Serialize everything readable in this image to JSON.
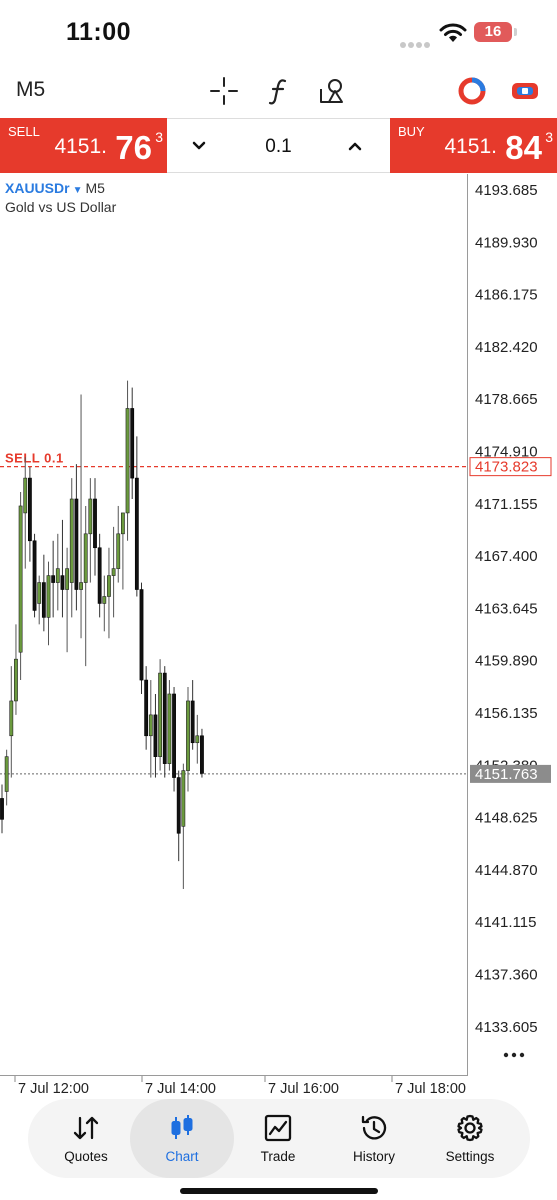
{
  "status_bar": {
    "time": "11:00",
    "battery": "16"
  },
  "toolbar": {
    "timeframe": "M5",
    "icons": [
      "crosshair-icon",
      "function-icon",
      "objects-icon",
      "account-icon",
      "one-click-trading-icon"
    ]
  },
  "trade": {
    "sell_label": "SELL",
    "sell_price_prefix": "4151.",
    "sell_price_big": "76",
    "sell_price_sup": "3",
    "buy_label": "BUY",
    "buy_price_prefix": "4151.",
    "buy_price_big": "84",
    "buy_price_sup": "3",
    "lot": "0.1"
  },
  "chart_header": {
    "symbol": "XAUUSDr",
    "timeframe": "M5",
    "description": "Gold vs US Dollar"
  },
  "colors": {
    "sell": "#e63a2c",
    "buy": "#e63a2c",
    "bull_candle": "#6b9a3e",
    "bear_candle": "#111111",
    "accent": "#1e6fe0",
    "order_line": "#e63a2c"
  },
  "chart_data": {
    "type": "candlestick",
    "price_axis": [
      "4193.685",
      "4189.930",
      "4186.175",
      "4182.420",
      "4178.665",
      "4174.910",
      "4171.155",
      "4167.400",
      "4163.645",
      "4159.890",
      "4156.135",
      "4152.380",
      "4148.625",
      "4144.870",
      "4141.115",
      "4137.360",
      "4133.605"
    ],
    "time_axis": [
      "7 Jul 12:00",
      "7 Jul 14:00",
      "7 Jul 16:00",
      "7 Jul 18:00"
    ],
    "order_line": {
      "label": "SELL 0.1",
      "price": 4173.823,
      "price_label": "4173.823"
    },
    "current_price": {
      "price": 4151.763,
      "price_label": "4151.763"
    },
    "ylim": [
      4130.0,
      4195.0
    ],
    "candles": [
      {
        "o": 4150.0,
        "h": 4151.0,
        "l": 4147.5,
        "c": 4148.5
      },
      {
        "o": 4150.5,
        "h": 4153.5,
        "l": 4149.5,
        "c": 4153.0
      },
      {
        "o": 4154.5,
        "h": 4159.5,
        "l": 4151.5,
        "c": 4157.0
      },
      {
        "o": 4157.0,
        "h": 4162.5,
        "l": 4156.0,
        "c": 4160.0
      },
      {
        "o": 4160.5,
        "h": 4172.0,
        "l": 4158.5,
        "c": 4171.0
      },
      {
        "o": 4170.5,
        "h": 4174.5,
        "l": 4166.5,
        "c": 4173.0
      },
      {
        "o": 4173.0,
        "h": 4173.8,
        "l": 4167.0,
        "c": 4168.5
      },
      {
        "o": 4168.5,
        "h": 4169.0,
        "l": 4163.0,
        "c": 4163.5
      },
      {
        "o": 4164.0,
        "h": 4166.0,
        "l": 4162.5,
        "c": 4165.5
      },
      {
        "o": 4165.5,
        "h": 4167.5,
        "l": 4162.0,
        "c": 4163.0
      },
      {
        "o": 4163.0,
        "h": 4167.0,
        "l": 4161.0,
        "c": 4166.0
      },
      {
        "o": 4166.0,
        "h": 4168.5,
        "l": 4163.0,
        "c": 4165.5
      },
      {
        "o": 4165.5,
        "h": 4169.0,
        "l": 4163.5,
        "c": 4166.5
      },
      {
        "o": 4166.0,
        "h": 4170.0,
        "l": 4163.0,
        "c": 4165.0
      },
      {
        "o": 4165.0,
        "h": 4168.0,
        "l": 4160.5,
        "c": 4166.5
      },
      {
        "o": 4165.5,
        "h": 4173.0,
        "l": 4163.0,
        "c": 4171.5
      },
      {
        "o": 4171.5,
        "h": 4174.0,
        "l": 4163.5,
        "c": 4165.0
      },
      {
        "o": 4165.0,
        "h": 4179.0,
        "l": 4161.5,
        "c": 4165.5
      },
      {
        "o": 4165.5,
        "h": 4171.0,
        "l": 4159.5,
        "c": 4169.0
      },
      {
        "o": 4169.0,
        "h": 4173.0,
        "l": 4165.5,
        "c": 4171.5
      },
      {
        "o": 4171.5,
        "h": 4173.0,
        "l": 4166.0,
        "c": 4168.0
      },
      {
        "o": 4168.0,
        "h": 4169.0,
        "l": 4163.0,
        "c": 4164.0
      },
      {
        "o": 4164.0,
        "h": 4166.0,
        "l": 4162.0,
        "c": 4164.5
      },
      {
        "o": 4164.5,
        "h": 4168.0,
        "l": 4161.5,
        "c": 4166.0
      },
      {
        "o": 4166.0,
        "h": 4169.5,
        "l": 4163.0,
        "c": 4166.5
      },
      {
        "o": 4166.5,
        "h": 4171.0,
        "l": 4165.5,
        "c": 4169.0
      },
      {
        "o": 4169.0,
        "h": 4170.0,
        "l": 4165.0,
        "c": 4170.5
      },
      {
        "o": 4170.5,
        "h": 4180.0,
        "l": 4168.5,
        "c": 4178.0
      },
      {
        "o": 4178.0,
        "h": 4179.5,
        "l": 4171.5,
        "c": 4173.0
      },
      {
        "o": 4173.0,
        "h": 4176.0,
        "l": 4164.5,
        "c": 4165.0
      },
      {
        "o": 4165.0,
        "h": 4165.5,
        "l": 4157.5,
        "c": 4158.5
      },
      {
        "o": 4158.5,
        "h": 4159.5,
        "l": 4153.5,
        "c": 4154.5
      },
      {
        "o": 4154.5,
        "h": 4158.5,
        "l": 4151.5,
        "c": 4156.0
      },
      {
        "o": 4156.0,
        "h": 4157.5,
        "l": 4151.5,
        "c": 4153.0
      },
      {
        "o": 4153.0,
        "h": 4160.0,
        "l": 4152.0,
        "c": 4159.0
      },
      {
        "o": 4159.0,
        "h": 4159.5,
        "l": 4151.5,
        "c": 4152.5
      },
      {
        "o": 4152.5,
        "h": 4158.5,
        "l": 4152.0,
        "c": 4157.5
      },
      {
        "o": 4157.5,
        "h": 4158.0,
        "l": 4150.5,
        "c": 4151.5
      },
      {
        "o": 4151.5,
        "h": 4152.0,
        "l": 4145.5,
        "c": 4147.5
      },
      {
        "o": 4148.0,
        "h": 4152.5,
        "l": 4143.5,
        "c": 4152.0
      },
      {
        "o": 4152.0,
        "h": 4158.0,
        "l": 4150.5,
        "c": 4157.0
      },
      {
        "o": 4157.0,
        "h": 4158.5,
        "l": 4153.5,
        "c": 4154.0
      },
      {
        "o": 4154.0,
        "h": 4156.0,
        "l": 4152.5,
        "c": 4154.5
      },
      {
        "o": 4154.5,
        "h": 4155.0,
        "l": 4151.5,
        "c": 4151.8
      }
    ]
  },
  "nav": {
    "items": [
      {
        "label": "Quotes",
        "icon": "quotes-icon"
      },
      {
        "label": "Chart",
        "icon": "chart-candles-icon"
      },
      {
        "label": "Trade",
        "icon": "trade-icon"
      },
      {
        "label": "History",
        "icon": "history-icon"
      },
      {
        "label": "Settings",
        "icon": "settings-icon"
      }
    ],
    "active": "Chart"
  }
}
